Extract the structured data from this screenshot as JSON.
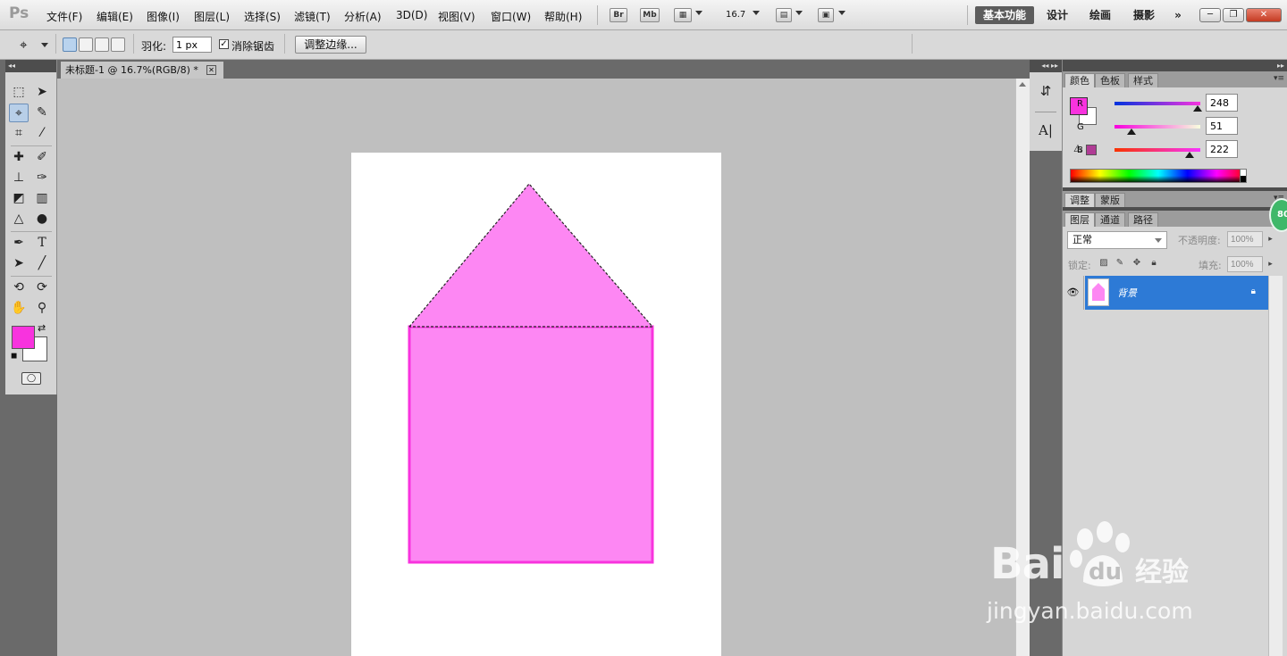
{
  "app": {
    "logo": "Ps"
  },
  "menu": [
    "文件(F)",
    "编辑(E)",
    "图像(I)",
    "图层(L)",
    "选择(S)",
    "滤镜(T)",
    "分析(A)",
    "3D(D)",
    "视图(V)",
    "窗口(W)",
    "帮助(H)"
  ],
  "appbar": {
    "bridge": "Br",
    "minibridge": "Mb",
    "zoom": "16.7"
  },
  "workspaces": [
    "基本功能",
    "设计",
    "绘画",
    "摄影"
  ],
  "workspace_more": "»",
  "options": {
    "feather_label": "羽化:",
    "feather_value": "1 px",
    "antialias_label": "消除锯齿",
    "antialias_checked": true,
    "refine_edge_button": "调整边缘..."
  },
  "document": {
    "tab_title": "未标题-1 @ 16.7%(RGB/8) *"
  },
  "colors": {
    "foreground": "#F833DE",
    "background": "#FFFFFF",
    "shape_fill": "#FD87F3",
    "shape_stroke": "#F833DE",
    "selection_highlight": "#2D7AD6"
  },
  "color_panel": {
    "tabs": [
      "颜色",
      "色板",
      "样式"
    ],
    "channels": [
      {
        "name": "R",
        "value": "248",
        "fraction": 0.973
      },
      {
        "name": "G",
        "value": "51",
        "fraction": 0.2
      },
      {
        "name": "B",
        "value": "222",
        "fraction": 0.871
      }
    ]
  },
  "adjust_panel": {
    "tabs": [
      "调整",
      "蒙版"
    ]
  },
  "layers_panel": {
    "tabs": [
      "图层",
      "通道",
      "路径"
    ],
    "blend_mode": "正常",
    "opacity_label": "不透明度:",
    "opacity_value": "100%",
    "lock_label": "锁定:",
    "fill_label": "填充:",
    "fill_value": "100%",
    "layers": [
      {
        "name": "背景",
        "selected": true,
        "locked": true
      }
    ]
  },
  "badge": "80",
  "watermark": {
    "main": "Bai",
    "secondary": "du",
    "cn": "经验",
    "url": "jingyan.baidu.com"
  }
}
